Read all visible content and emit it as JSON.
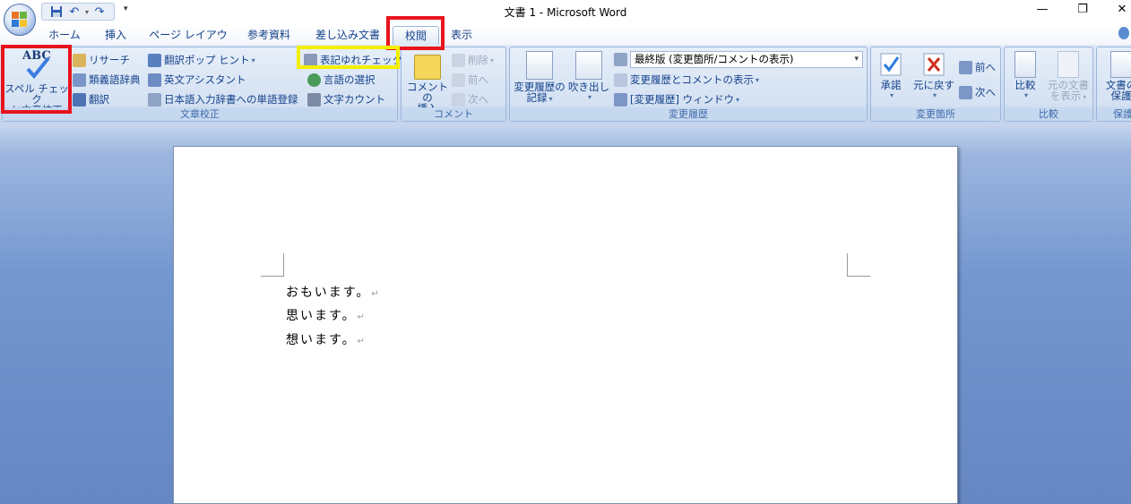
{
  "title": {
    "window_title": "文書 1 - Microsoft Word",
    "minimize": "—",
    "restore": "❐",
    "close": "✕"
  },
  "tabs": [
    "ホーム",
    "挿入",
    "ページ レイアウト",
    "参考資料",
    "差し込み文書",
    "校閲",
    "表示"
  ],
  "ribbon": {
    "proofing": {
      "label": "文章校正",
      "spell_line1": "スペル チェック",
      "spell_line2": "と文章校正",
      "abc": "ABC",
      "research": "リサーチ",
      "thesaurus": "類義語辞典",
      "translate": "翻訳",
      "translate_tip": "翻訳ポップ ヒント",
      "english_assist": "英文アシスタント",
      "ime_register": "日本語入力辞書への単語登録",
      "notation_check": "表記ゆれチェック",
      "language": "言語の選択",
      "word_count": "文字カウント"
    },
    "comments": {
      "label": "コメント",
      "insert_line1": "コメントの",
      "insert_line2": "挿入",
      "delete": "削除",
      "prev": "前へ",
      "next": "次へ"
    },
    "tracking": {
      "label": "変更履歴",
      "track_line1": "変更履歴の",
      "track_line2": "記録",
      "balloons": "吹き出し",
      "display_mode": "最終版 (変更箇所/コメントの表示)",
      "show_markup": "変更履歴とコメントの表示",
      "review_pane": "[変更履歴] ウィンドウ"
    },
    "changes": {
      "label": "変更箇所",
      "accept": "承諾",
      "reject": "元に戻す",
      "prev": "前へ",
      "next": "次へ"
    },
    "compare": {
      "label": "比較",
      "compare": "比較",
      "show_source_line1": "元の文書",
      "show_source_line2": "を表示"
    },
    "protect": {
      "label": "保護",
      "protect_line1": "文書の",
      "protect_line2": "保護"
    }
  },
  "document": {
    "lines": [
      "おもいます。",
      "思います。",
      "想います。"
    ],
    "para_mark": "↵"
  },
  "colors": {
    "highlight_red": "#e8131c",
    "highlight_yellow": "#f4ef00",
    "ribbon_text": "#15428b"
  }
}
